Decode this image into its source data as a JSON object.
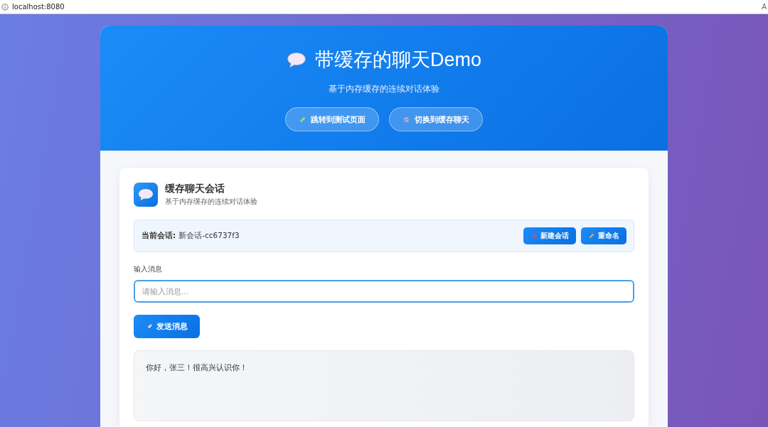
{
  "address_bar": {
    "url": "localhost:8080",
    "edge_text": "A"
  },
  "header": {
    "title": "带缓存的聊天Demo",
    "subtitle": "基于内存缓存的连续对话体验",
    "buttons": [
      {
        "label": "跳转到测试页面",
        "kind": "pencil"
      },
      {
        "label": "切换到缓存聊天",
        "kind": "refresh"
      }
    ]
  },
  "session": {
    "title": "缓存聊天会话",
    "subtitle": "基于内存缓存的连续对话体验",
    "current_label": "当前会话:",
    "current_value": "新会话-cc6737f3",
    "buttons": [
      {
        "label": "新建会话",
        "kind": "plus"
      },
      {
        "label": "重命名",
        "kind": "pencil"
      }
    ]
  },
  "input": {
    "label": "输入消息",
    "placeholder": "请输入消息..."
  },
  "send_button": {
    "label": "发送消息"
  },
  "messages": [
    {
      "text": "你好，张三！很高兴认识你！"
    }
  ]
}
